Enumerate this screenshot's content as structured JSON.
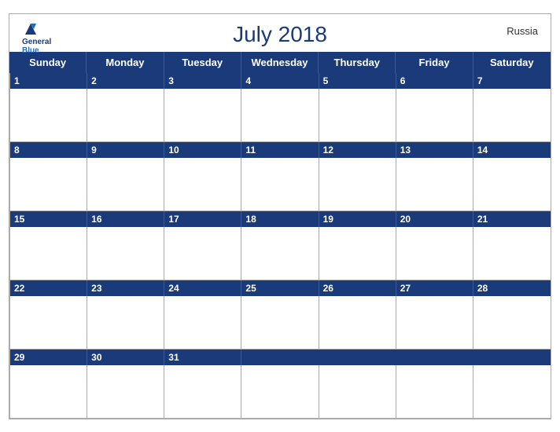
{
  "header": {
    "title": "July 2018",
    "country": "Russia",
    "logo": {
      "general": "General",
      "blue": "Blue"
    }
  },
  "days_of_week": [
    "Sunday",
    "Monday",
    "Tuesday",
    "Wednesday",
    "Thursday",
    "Friday",
    "Saturday"
  ],
  "weeks": [
    [
      1,
      2,
      3,
      4,
      5,
      6,
      7
    ],
    [
      8,
      9,
      10,
      11,
      12,
      13,
      14
    ],
    [
      15,
      16,
      17,
      18,
      19,
      20,
      21
    ],
    [
      22,
      23,
      24,
      25,
      26,
      27,
      28
    ],
    [
      29,
      30,
      31,
      null,
      null,
      null,
      null
    ]
  ]
}
